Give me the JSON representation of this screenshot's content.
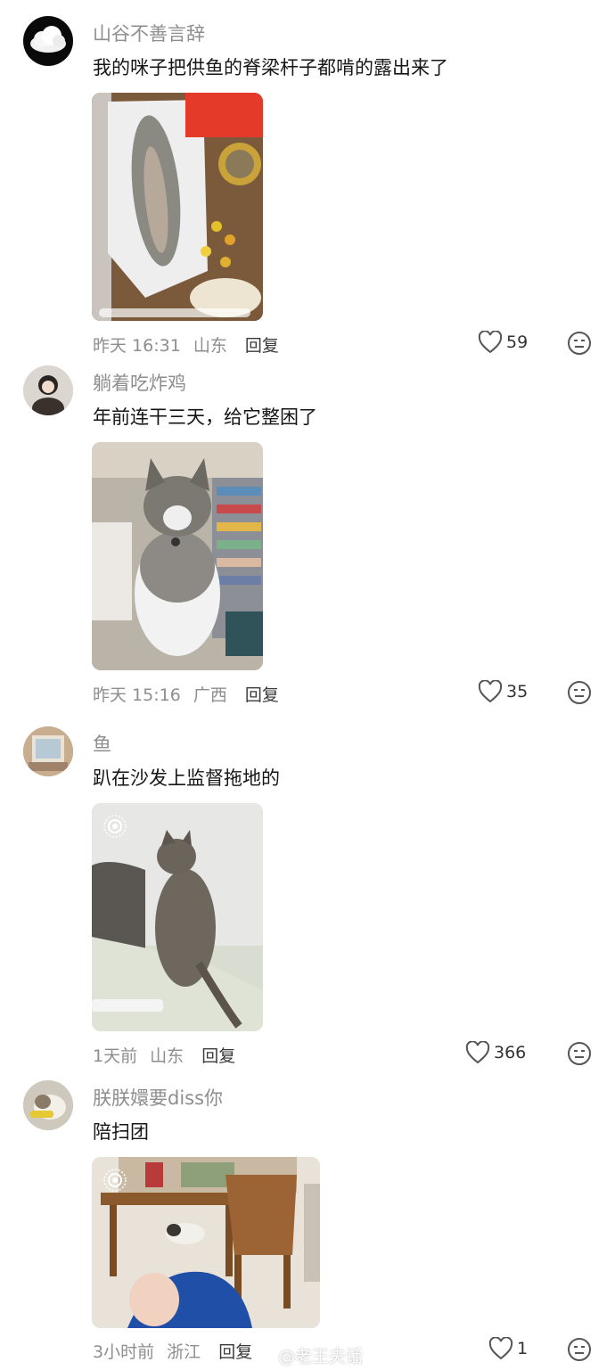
{
  "comments": [
    {
      "username": "山谷不善言辞",
      "text": "我的咪子把供鱼的脊梁杆子都啃的露出来了",
      "time": "昨天 16:31",
      "location": "山东",
      "reply_label": "回复",
      "likes": "59",
      "media": "fish-offering-photo"
    },
    {
      "username": "躺着吃炸鸡",
      "text": "年前连干三天，给它整困了",
      "time": "昨天 15:16",
      "location": "广西",
      "reply_label": "回复",
      "likes": "35",
      "media": "sleepy-cat-photo"
    },
    {
      "username": "鱼",
      "text": "趴在沙发上监督拖地的",
      "time": "1天前",
      "location": "山东",
      "reply_label": "回复",
      "likes": "366",
      "media": "tabby-cat-sofa-live-photo"
    },
    {
      "username": "朕朕嬛要diss你",
      "text": "陪扫团",
      "time": "3小时前",
      "location": "浙江",
      "reply_label": "回复",
      "likes": "1",
      "media": "dining-room-live-photo"
    }
  ],
  "watermark": "@老王夫话",
  "colors": {
    "meta_text": "#8e8e8e",
    "body_text": "#161616",
    "icon": "#555555"
  }
}
